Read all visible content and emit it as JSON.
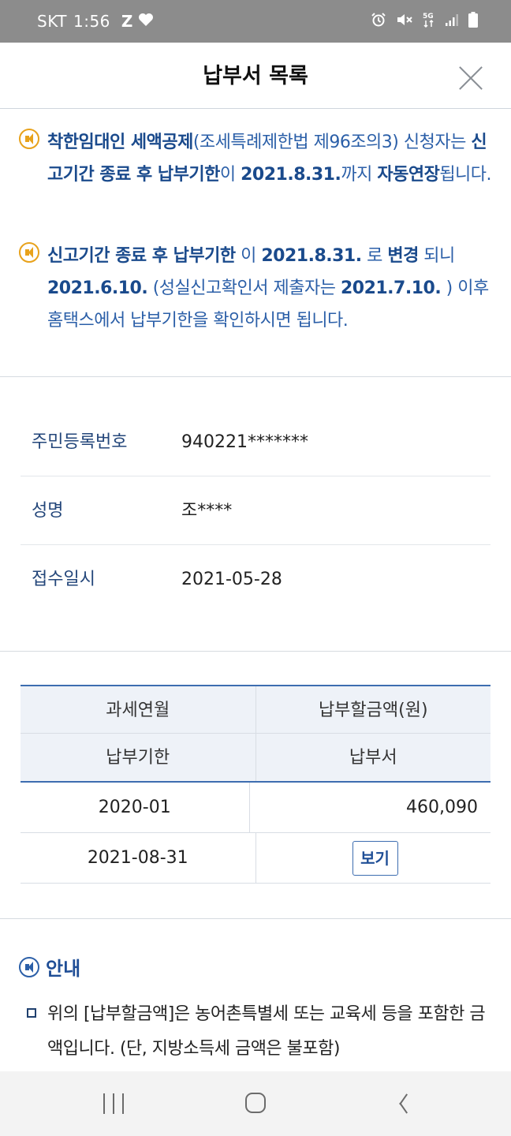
{
  "status_bar": {
    "carrier": "SKT",
    "time": "1:56",
    "notif_z": "Z",
    "network": "5G"
  },
  "header": {
    "title": "납부서 목록"
  },
  "notices": [
    {
      "parts": [
        {
          "t": "착한임대인 세액공제",
          "b": true
        },
        {
          "t": "(조세특례제한법 제96조의3) 신청자는 ",
          "b": false
        },
        {
          "t": "신고기간 종료 후 납부기한",
          "b": true
        },
        {
          "t": "이 ",
          "b": false
        },
        {
          "t": "2021.8.31.",
          "b": true
        },
        {
          "t": "까지 ",
          "b": false
        },
        {
          "t": "자동연장",
          "b": true
        },
        {
          "t": "됩니다.",
          "b": false
        }
      ]
    },
    {
      "parts": [
        {
          "t": "신고기간 종료 후 납부기한",
          "b": true
        },
        {
          "t": " 이 ",
          "b": false
        },
        {
          "t": "2021.8.31.",
          "b": true
        },
        {
          "t": " 로 ",
          "b": false
        },
        {
          "t": "변경",
          "b": true
        },
        {
          "t": " 되니 ",
          "b": false
        },
        {
          "t": "2021.6.10.",
          "b": true
        },
        {
          "t": " (성실신고확인서 제출자는 ",
          "b": false
        },
        {
          "t": "2021.7.10.",
          "b": true
        },
        {
          "t": " ) 이후 홈택스에서 납부기한을 확인하시면 됩니다.",
          "b": false
        }
      ]
    }
  ],
  "info": {
    "rows": [
      {
        "label": "주민등록번호",
        "value": "940221*******"
      },
      {
        "label": "성명",
        "value": "조****"
      },
      {
        "label": "접수일시",
        "value": "2021-05-28"
      }
    ]
  },
  "table": {
    "headers": [
      [
        "과세연월",
        "납부할금액(원)"
      ],
      [
        "납부기한",
        "납부서"
      ]
    ],
    "rows": [
      {
        "period": "2020-01",
        "amount": "460,090",
        "due_date": "2021-08-31",
        "view_label": "보기"
      }
    ]
  },
  "guide": {
    "title": "안내",
    "items": [
      "위의 [납부할금액]은 농어촌특별세 또는 교육세 등을 포함한 금액입니다. (단, 지방소득세 금액은 불포함)"
    ]
  },
  "navbar": {
    "icons": [
      "recent-apps-icon",
      "home-icon",
      "back-icon"
    ]
  },
  "colors": {
    "accent": "#2b5fa8",
    "notice_icon": "#e8a21b",
    "table_border": "#3d6db0",
    "table_header_bg": "#eef2f8"
  }
}
